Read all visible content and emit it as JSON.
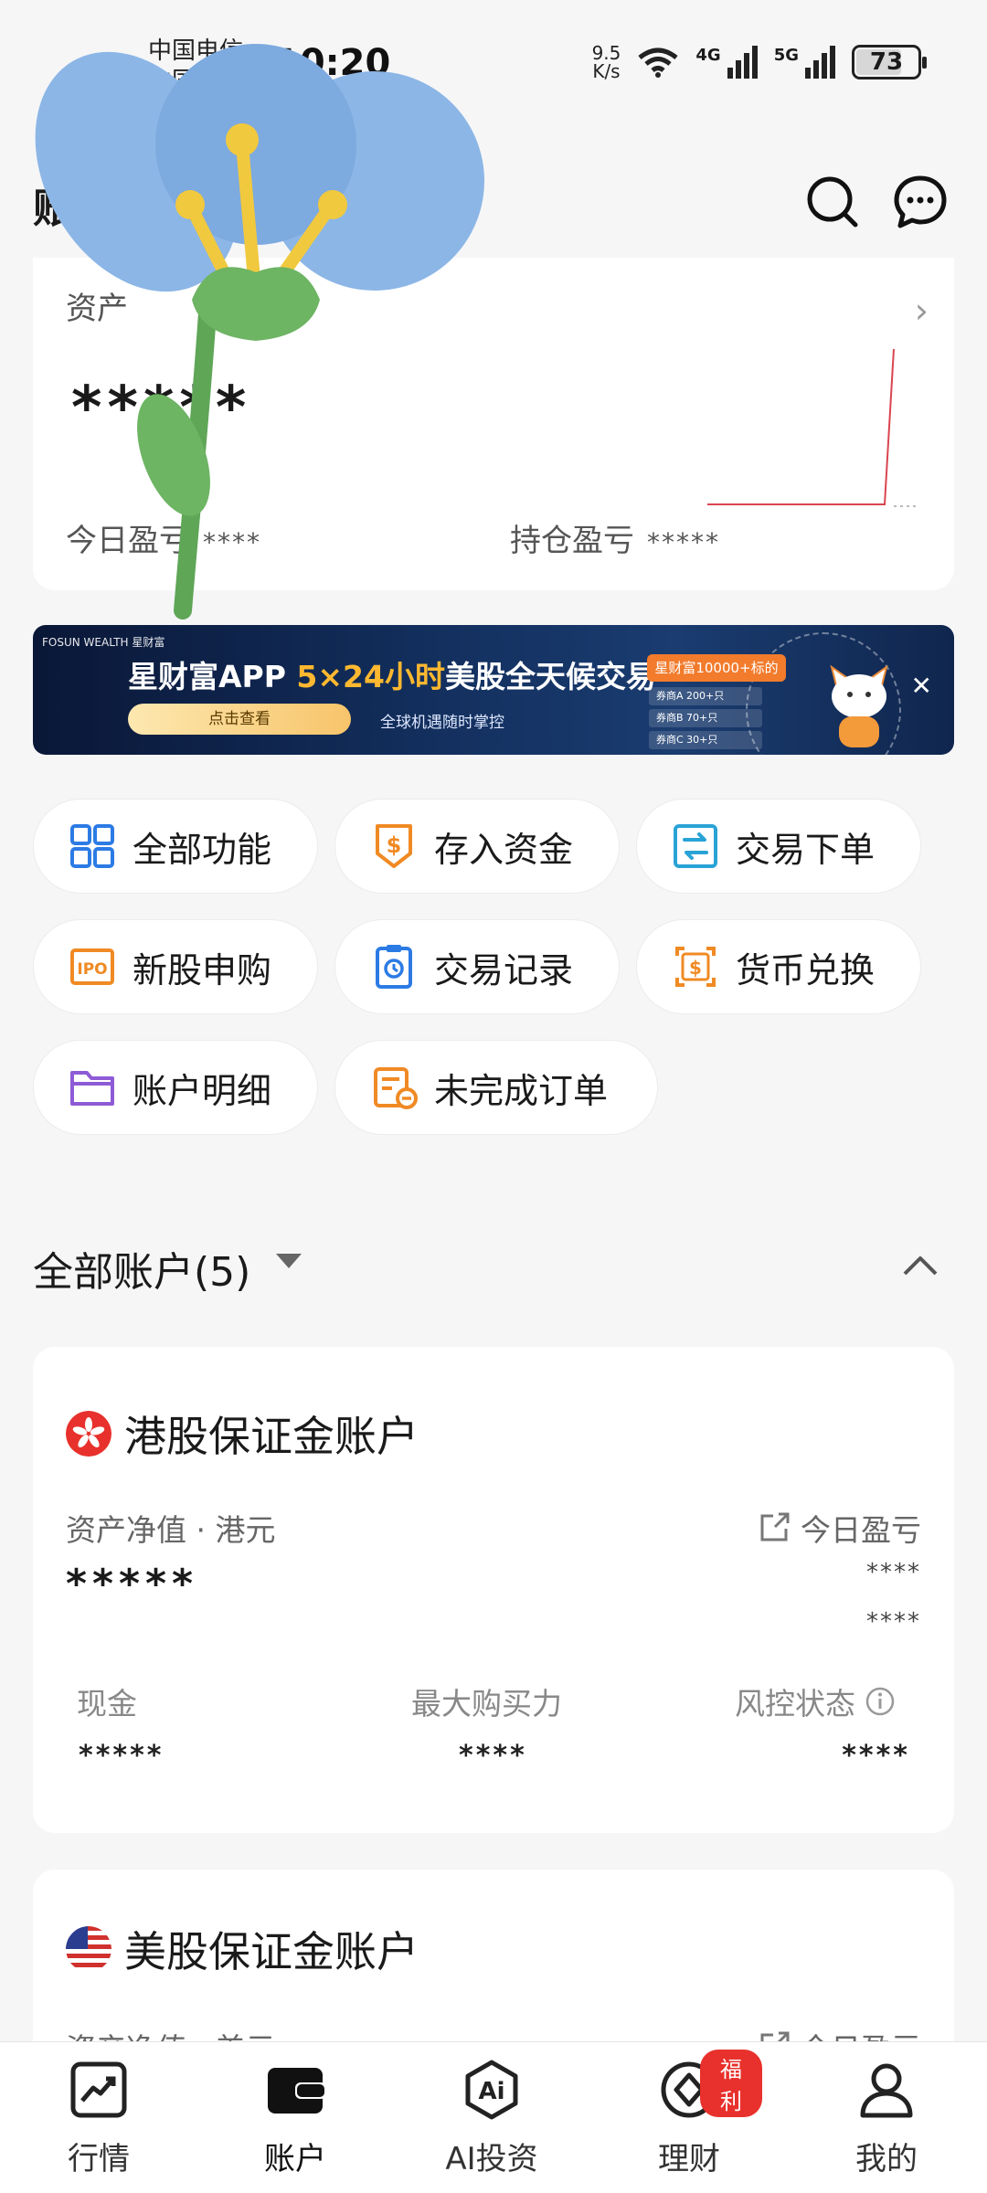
{
  "status_bar": {
    "carrier_1": "中国电信",
    "carrier_2": "中国移动",
    "time": "10:20",
    "net_speed_value": "9.5",
    "net_speed_unit": "K/s",
    "signal_1": "4G",
    "signal_2": "5G",
    "battery": "73"
  },
  "header": {
    "title": "账户",
    "search_icon": "search-icon",
    "message_icon": "message-icon"
  },
  "asset_card": {
    "label": "资产",
    "value": "*****",
    "today_label": "今日盈亏",
    "today_value": "****",
    "hold_label": "持仓盈亏",
    "hold_value": "*****"
  },
  "banner": {
    "brand": "FOSUN WEALTH 星财富",
    "title_prefix": "星财富APP ",
    "title_highlight": "5×24小时",
    "title_suffix": "美股全天候交易",
    "button": "点击查看",
    "subtitle": "全球机遇随时掌控",
    "tag": "星财富10000+标的",
    "list": [
      "券商A 200+只",
      "券商B 70+只",
      "券商C 30+只"
    ]
  },
  "functions": [
    {
      "label": "全部功能",
      "icon": "grid-icon"
    },
    {
      "label": "存入资金",
      "icon": "deposit-icon"
    },
    {
      "label": "交易下单",
      "icon": "trade-icon"
    },
    {
      "label": "新股申购",
      "icon": "ipo-icon"
    },
    {
      "label": "交易记录",
      "icon": "record-icon"
    },
    {
      "label": "货币兑换",
      "icon": "exchange-icon"
    },
    {
      "label": "账户明细",
      "icon": "folder-icon"
    },
    {
      "label": "未完成订单",
      "icon": "pending-order-icon"
    }
  ],
  "accounts_section": {
    "title": "全部账户(5)"
  },
  "hk_account": {
    "title": "港股保证金账户",
    "net_label": "资产净值 · 港元",
    "today_label": "今日盈亏",
    "net_value": "*****",
    "today_value_1": "****",
    "today_value_2": "****",
    "cash_label": "现金",
    "cash_value": "*****",
    "buying_label": "最大购买力",
    "buying_value": "****",
    "risk_label": "风控状态",
    "risk_value": "****"
  },
  "us_account": {
    "title": "美股保证金账户",
    "net_label": "资产净值 · 美元",
    "today_label": "今日盈亏"
  },
  "tabbar": [
    {
      "label": "行情",
      "icon": "market-icon"
    },
    {
      "label": "账户",
      "icon": "wallet-icon"
    },
    {
      "label": "AI投资",
      "icon": "ai-icon"
    },
    {
      "label": "理财",
      "icon": "wealth-icon",
      "badge": "福利"
    },
    {
      "label": "我的",
      "icon": "person-icon"
    }
  ],
  "colors": {
    "accent_orange": "#f08a24",
    "accent_blue": "#2c7be5",
    "badge_red": "#e8312c"
  }
}
